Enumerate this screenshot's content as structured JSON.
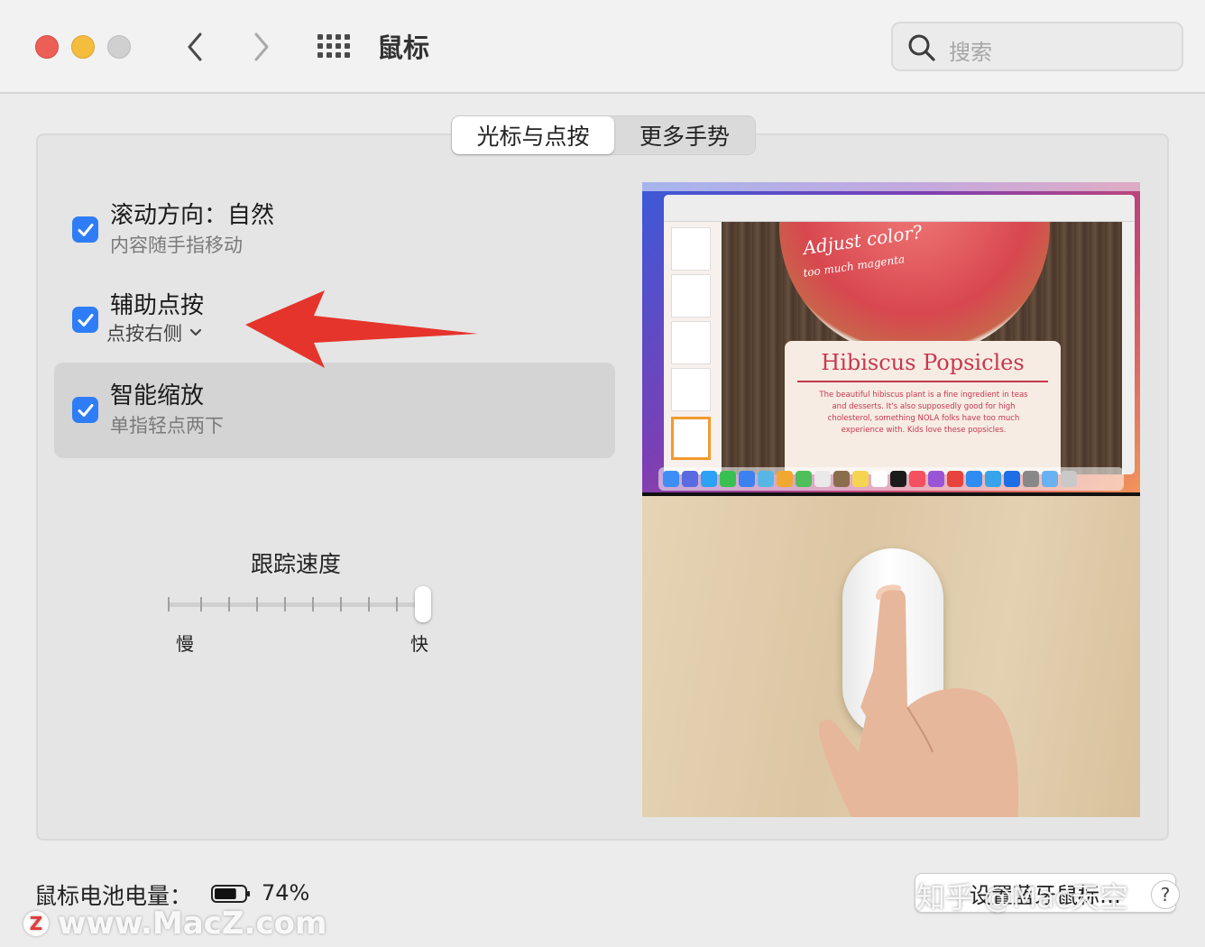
{
  "window": {
    "title": "鼠标",
    "search_placeholder": "搜索"
  },
  "tabs": [
    {
      "label": "光标与点按",
      "selected": true
    },
    {
      "label": "更多手势",
      "selected": false
    }
  ],
  "options": [
    {
      "title": "滚动方向：自然",
      "subtitle": "内容随手指移动",
      "checked": true
    },
    {
      "title": "辅助点按",
      "dropdown": "点按右侧",
      "checked": true
    },
    {
      "title": "智能缩放",
      "subtitle": "单指轻点两下",
      "checked": true,
      "highlighted": true
    }
  ],
  "tracking": {
    "title": "跟踪速度",
    "min_label": "慢",
    "max_label": "快",
    "value_fraction": 1.0
  },
  "preview": {
    "doc_title": "Hibiscus Popsicles",
    "handwriting_line1": "Adjust color?",
    "handwriting_line2": "too much magenta",
    "doc_text": "The beautiful hibiscus plant is a fine ingredient in teas and desserts. It's also supposedly good for high cholesterol, something NOLA folks have too much experience with. Kids love these popsicles."
  },
  "footer": {
    "battery_label": "鼠标电池电量：",
    "battery_percent": "74%",
    "battery_level": 0.74,
    "setup_button": "设置蓝牙鼠标…",
    "help": "?"
  },
  "watermarks": {
    "zhihu": "知乎 @Mac天空",
    "macz_logo": "Z",
    "macz": "www.MacZ.com"
  },
  "colors": {
    "accent": "#2f7df6",
    "arrow": "#e5342b",
    "close": "#ec5f57",
    "minimize": "#f5bd3d"
  }
}
